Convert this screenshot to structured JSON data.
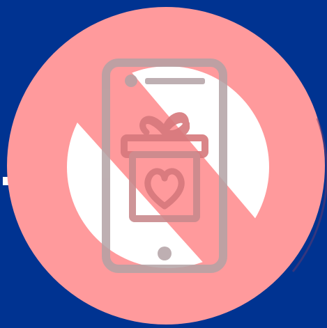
{
  "colors": {
    "background": "#003391",
    "prohibition_circle": "#FF9A9C",
    "inner_disc": "#FFFFFF",
    "phone_outline": "#B9A7A9",
    "gift_outline": "#D47A7E",
    "edge_accent": "#FFFFFF"
  },
  "icons": {
    "main": "no-mobile-gift-icon",
    "phone": "smartphone-icon",
    "gift": "gift-box-heart-icon",
    "sign": "prohibition-sign-icon"
  }
}
